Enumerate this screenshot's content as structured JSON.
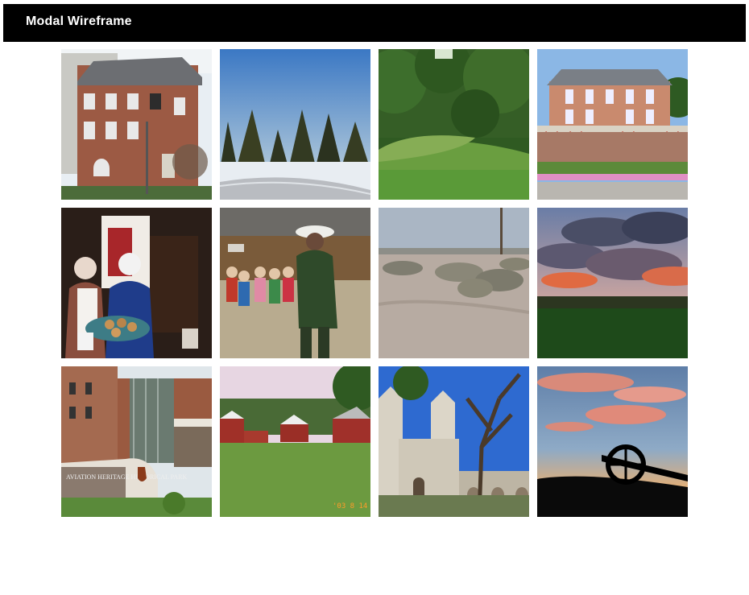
{
  "header": {
    "title": "Modal Wireframe"
  },
  "gallery": {
    "tiles": [
      {
        "subject": "brick townhouse with street lamp"
      },
      {
        "subject": "snowy pine forest at dusk"
      },
      {
        "subject": "green grassy mounds in forest clearing"
      },
      {
        "subject": "victorian mansion with bunting"
      },
      {
        "subject": "two women in period dress with bread"
      },
      {
        "subject": "ranger talking to school children"
      },
      {
        "subject": "desert sagebrush landscape"
      },
      {
        "subject": "dramatic sunset clouds over field"
      },
      {
        "subject": "aviation heritage historical park building"
      },
      {
        "subject": "red farm buildings on lawn"
      },
      {
        "subject": "stone mission church with tree"
      },
      {
        "subject": "cannon silhouette at sunset"
      }
    ],
    "captions": {
      "park_sign": "AVIATION HERITAGE HISTORICAL PARK",
      "date_stamp": "'03 8 14"
    }
  }
}
